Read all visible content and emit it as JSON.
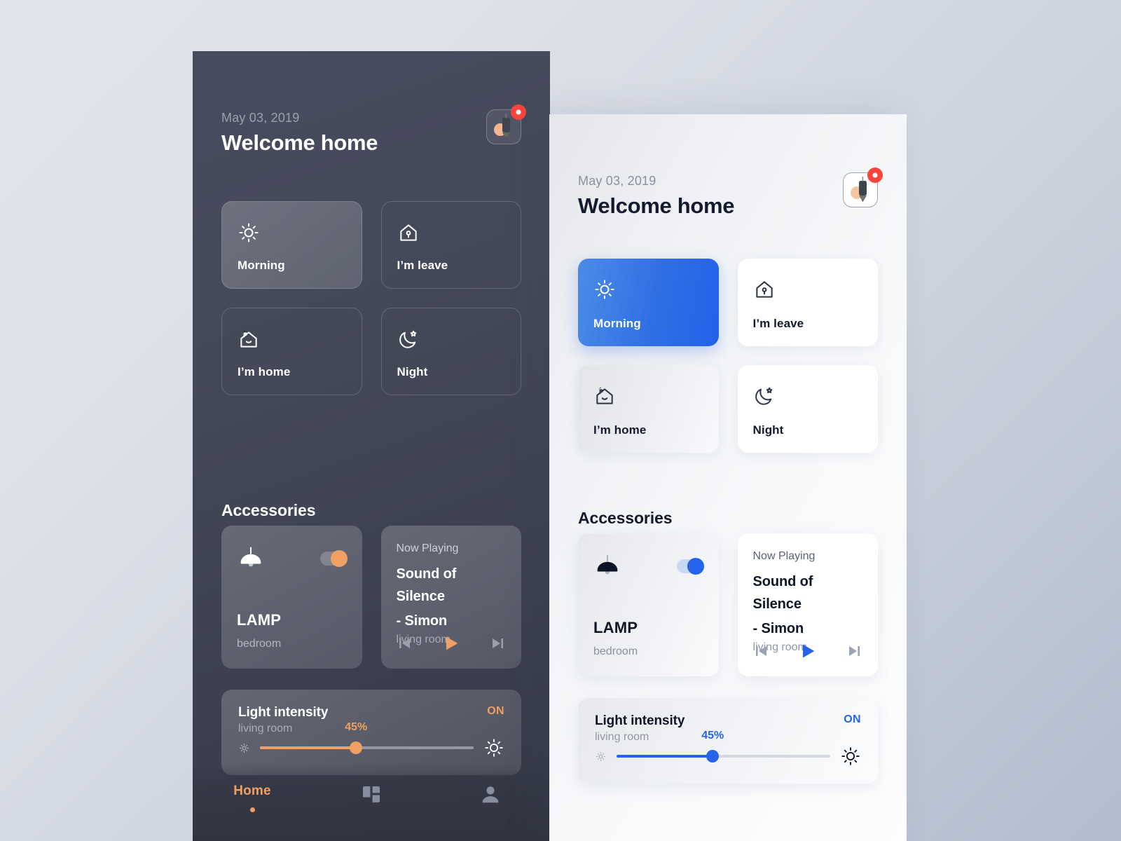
{
  "colors": {
    "dark_panel_bg": "#464b5e",
    "light_panel_bg": "#f5f6f8",
    "page_bg_start": "#e0e4ea",
    "page_bg_end": "#b2bccd",
    "accent_dark": "#f0a063",
    "accent_light": "#2563eb",
    "notification_red": "#f9453e"
  },
  "header": {
    "date": "May 03, 2019",
    "title": "Welcome home",
    "app_badge_icon": "pen-tool-icon",
    "notification_badge": "notification-dot"
  },
  "scenes": [
    {
      "label": "Morning",
      "icon": "sun-icon",
      "active": true
    },
    {
      "label": "I’m leave",
      "icon": "house-lock-icon",
      "active": false
    },
    {
      "label": "I’m home",
      "icon": "house-smile-icon",
      "active": false
    },
    {
      "label": "Night",
      "icon": "moon-star-icon",
      "active": false
    }
  ],
  "accessories": {
    "heading": "Accessories",
    "lamp": {
      "icon": "pendant-lamp-icon",
      "name": "LAMP",
      "room": "bedroom",
      "toggle_state": "on"
    },
    "media": {
      "now_playing_label": "Now Playing",
      "track_line1": "Sound of Silence",
      "track_line2": "- Simon",
      "room": "living room",
      "controls": [
        {
          "name": "previous-track-button",
          "icon": "skip-back-icon"
        },
        {
          "name": "play-button",
          "icon": "play-icon"
        },
        {
          "name": "next-track-button",
          "icon": "skip-forward-icon"
        }
      ]
    }
  },
  "intensity": {
    "title": "Light intensity",
    "room": "living room",
    "state": "ON",
    "value_label": "45%",
    "value": 45,
    "min_icon": "small-sun-icon",
    "max_icon": "large-sun-icon"
  },
  "bottom_nav": [
    {
      "label": "Home",
      "icon": "",
      "active": true
    },
    {
      "label": "",
      "icon": "dashboard-icon",
      "active": false
    },
    {
      "label": "",
      "icon": "person-icon",
      "active": false
    }
  ]
}
